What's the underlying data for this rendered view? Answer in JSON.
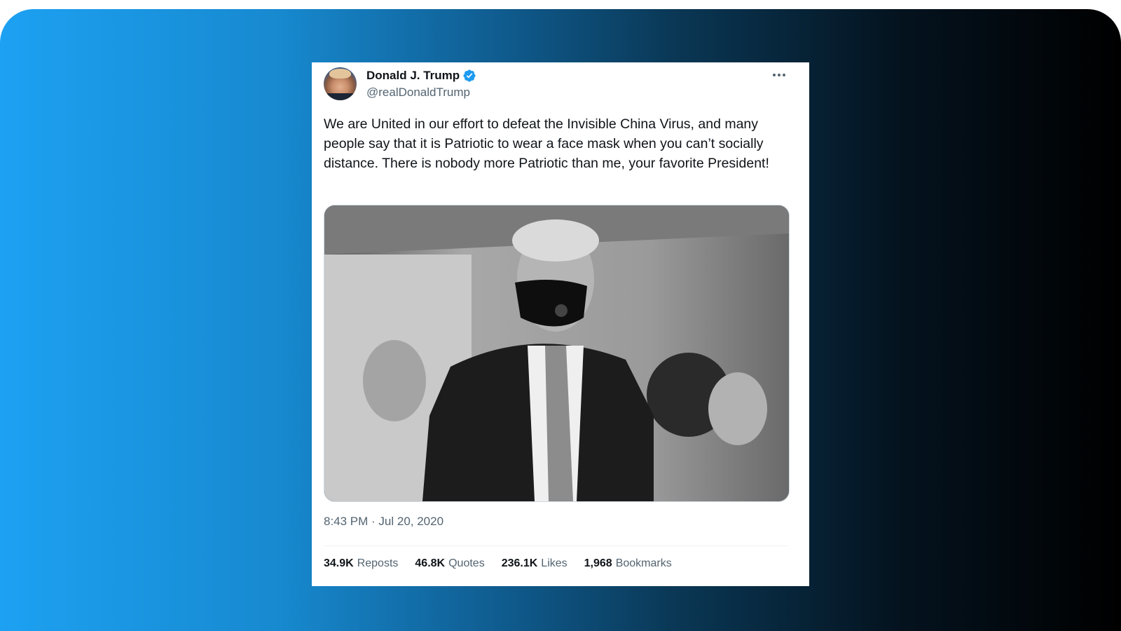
{
  "tweet": {
    "author": {
      "name": "Donald J. Trump",
      "handle": "@realDonaldTrump",
      "verified_icon": "verified-badge-icon",
      "verified_color": "#1d9bf0"
    },
    "text": "We are United in our effort to defeat the Invisible China Virus, and many people say that it is Patriotic to wear a face mask when you can’t socially distance. There is nobody more Patriotic than me, your favorite President!",
    "media": {
      "description_icon": "photo"
    },
    "timestamp": "8:43 PM · Jul 20, 2020",
    "stats": [
      {
        "count": "34.9K",
        "label": "Reposts"
      },
      {
        "count": "46.8K",
        "label": "Quotes"
      },
      {
        "count": "236.1K",
        "label": "Likes"
      },
      {
        "count": "1,968",
        "label": "Bookmarks"
      }
    ]
  },
  "colors": {
    "gradient_start": "#1da1f2",
    "gradient_end": "#000000",
    "text_primary": "#0f1419",
    "text_secondary": "#536471"
  }
}
